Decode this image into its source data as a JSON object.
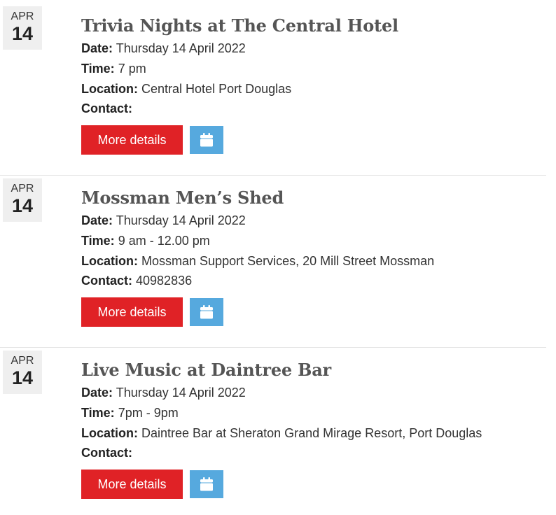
{
  "labels": {
    "date": "Date:",
    "time": "Time:",
    "location": "Location:",
    "contact": "Contact:"
  },
  "events": [
    {
      "month": "APR",
      "day": "14",
      "title": "Trivia Nights at The Central Hotel",
      "date": "Thursday 14 April 2022",
      "time": "7 pm",
      "location": "Central Hotel Port Douglas",
      "contact": "",
      "more_label": "More details",
      "calendar_icon": "calendar-icon"
    },
    {
      "month": "APR",
      "day": "14",
      "title": "Mossman Men’s Shed",
      "date": "Thursday 14 April 2022",
      "time": "9 am - 12.00 pm",
      "location": "Mossman Support Services, 20 Mill Street Mossman",
      "contact": "40982836",
      "more_label": "More details",
      "calendar_icon": "calendar-icon"
    },
    {
      "month": "APR",
      "day": "14",
      "title": "Live Music at Daintree Bar",
      "date": "Thursday 14 April 2022",
      "time": "7pm - 9pm",
      "location": "Daintree Bar at Sheraton Grand Mirage Resort, Port Douglas",
      "contact": "",
      "more_label": "More details",
      "calendar_icon": "calendar-icon"
    }
  ],
  "colors": {
    "more_button": "#e02226",
    "calendar_button": "#56a9de",
    "date_badge_bg": "#efefef",
    "title_text": "#555555"
  }
}
